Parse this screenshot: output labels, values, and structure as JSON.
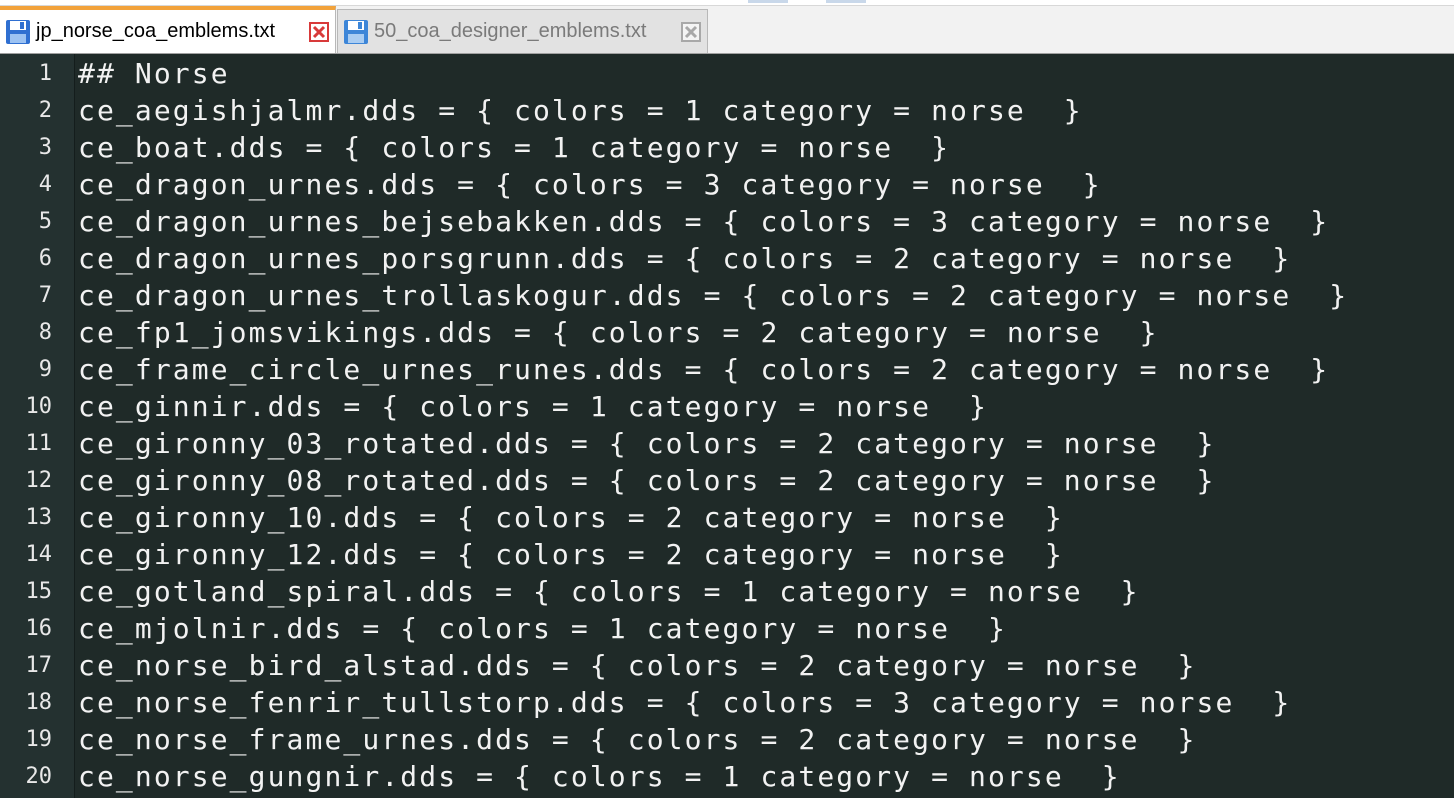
{
  "tabs": [
    {
      "label": "jp_norse_coa_emblems.txt",
      "active": true
    },
    {
      "label": "50_coa_designer_emblems.txt",
      "active": false
    }
  ],
  "editor": {
    "lines": [
      {
        "number": "1",
        "text": "## Norse"
      },
      {
        "number": "2",
        "text": "ce_aegishjalmr.dds = { colors = 1 category = norse  }"
      },
      {
        "number": "3",
        "text": "ce_boat.dds = { colors = 1 category = norse  }"
      },
      {
        "number": "4",
        "text": "ce_dragon_urnes.dds = { colors = 3 category = norse  }"
      },
      {
        "number": "5",
        "text": "ce_dragon_urnes_bejsebakken.dds = { colors = 3 category = norse  }"
      },
      {
        "number": "6",
        "text": "ce_dragon_urnes_porsgrunn.dds = { colors = 2 category = norse  }"
      },
      {
        "number": "7",
        "text": "ce_dragon_urnes_trollaskogur.dds = { colors = 2 category = norse  }"
      },
      {
        "number": "8",
        "text": "ce_fp1_jomsvikings.dds = { colors = 2 category = norse  }"
      },
      {
        "number": "9",
        "text": "ce_frame_circle_urnes_runes.dds = { colors = 2 category = norse  }"
      },
      {
        "number": "10",
        "text": "ce_ginnir.dds = { colors = 1 category = norse  }"
      },
      {
        "number": "11",
        "text": "ce_gironny_03_rotated.dds = { colors = 2 category = norse  }"
      },
      {
        "number": "12",
        "text": "ce_gironny_08_rotated.dds = { colors = 2 category = norse  }"
      },
      {
        "number": "13",
        "text": "ce_gironny_10.dds = { colors = 2 category = norse  }"
      },
      {
        "number": "14",
        "text": "ce_gironny_12.dds = { colors = 2 category = norse  }"
      },
      {
        "number": "15",
        "text": "ce_gotland_spiral.dds = { colors = 1 category = norse  }"
      },
      {
        "number": "16",
        "text": "ce_mjolnir.dds = { colors = 1 category = norse  }"
      },
      {
        "number": "17",
        "text": "ce_norse_bird_alstad.dds = { colors = 2 category = norse  }"
      },
      {
        "number": "18",
        "text": "ce_norse_fenrir_tullstorp.dds = { colors = 3 category = norse  }"
      },
      {
        "number": "19",
        "text": "ce_norse_frame_urnes.dds = { colors = 2 category = norse  }"
      },
      {
        "number": "20",
        "text": "ce_norse_gungnir.dds = { colors = 1 category = norse  }"
      }
    ]
  },
  "colors": {
    "editor_background": "#1f2a28",
    "gutter_background": "#243130",
    "text": "#f2f2f2",
    "active_tab_accent": "#f2a23a",
    "close_icon": "#d83a3a"
  },
  "icons": {
    "file": "save-icon",
    "close": "close-icon"
  }
}
